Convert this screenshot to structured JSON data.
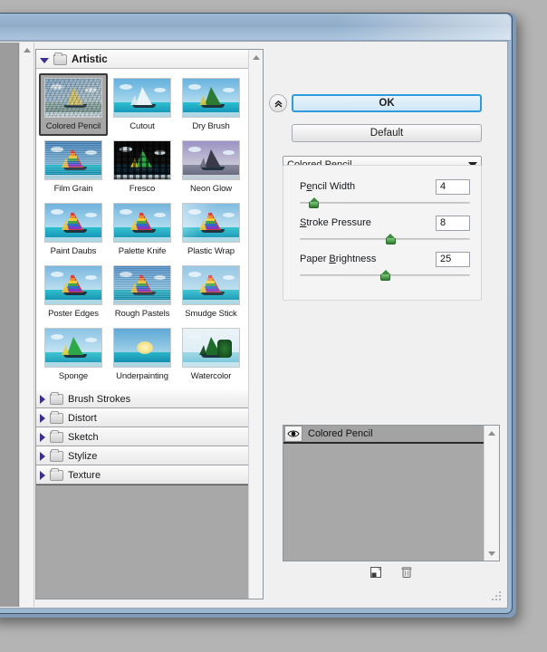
{
  "window": {
    "titlebar_title": "",
    "ok_label": "OK",
    "default_label": "Default",
    "collapse_icon": "«"
  },
  "browser": {
    "open_category": "Artistic",
    "filters": [
      {
        "label": "Colored Pencil",
        "selected": true
      },
      {
        "label": "Cutout",
        "selected": false
      },
      {
        "label": "Dry Brush",
        "selected": false
      },
      {
        "label": "Film Grain",
        "selected": false
      },
      {
        "label": "Fresco",
        "selected": false
      },
      {
        "label": "Neon Glow",
        "selected": false
      },
      {
        "label": "Paint Daubs",
        "selected": false
      },
      {
        "label": "Palette Knife",
        "selected": false
      },
      {
        "label": "Plastic Wrap",
        "selected": false
      },
      {
        "label": "Poster Edges",
        "selected": false
      },
      {
        "label": "Rough Pastels",
        "selected": false
      },
      {
        "label": "Smudge Stick",
        "selected": false
      },
      {
        "label": "Sponge",
        "selected": false
      },
      {
        "label": "Underpainting",
        "selected": false
      },
      {
        "label": "Watercolor",
        "selected": false
      }
    ],
    "categories": [
      {
        "label": "Brush Strokes"
      },
      {
        "label": "Distort"
      },
      {
        "label": "Sketch"
      },
      {
        "label": "Stylize"
      },
      {
        "label": "Texture"
      }
    ]
  },
  "settings": {
    "filter_select_value": "Colored Pencil",
    "params": [
      {
        "label_pre": "P",
        "label_accel": "e",
        "label_post": "ncil Width",
        "full_label": "Pencil Width",
        "value": "4",
        "percent": 8
      },
      {
        "label_pre": "",
        "label_accel": "S",
        "label_post": "troke Pressure",
        "full_label": "Stroke Pressure",
        "value": "8",
        "percent": 53
      },
      {
        "label_pre": "Paper ",
        "label_accel": "B",
        "label_post": "rightness",
        "full_label": "Paper Brightness",
        "value": "25",
        "percent": 50
      }
    ]
  },
  "layers": {
    "items": [
      {
        "label": "Colored Pencil",
        "visible": true
      }
    ]
  },
  "toolbar": {
    "new_effect_layer_label": "new-effect-layer",
    "delete_layer_label": "delete-effect-layer"
  },
  "colors": {
    "accent_blue": "#2e9bdc",
    "title_blue": "#9cb7d3",
    "panel_gray": "#a8a8a8",
    "slider_green": "#2f7a2f"
  }
}
